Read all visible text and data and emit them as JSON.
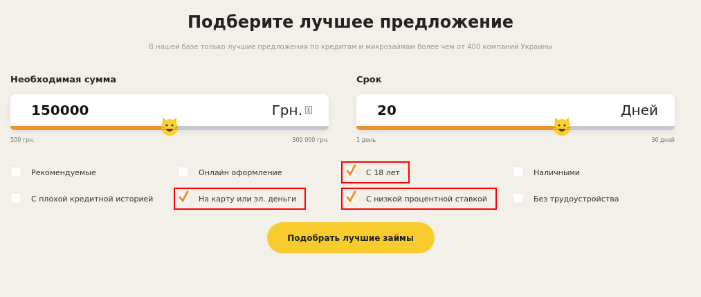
{
  "title": "Подберите лучшее предложение",
  "subtitle": "В нашей базе только лучшие предложения по кредитам и микрозаймам более чем от 400 компаний Украины",
  "sliders": [
    {
      "label": "Необходимая сумма",
      "value": "150000",
      "unit": "Грн.",
      "unit_icon": true,
      "level": 0.5,
      "min_label": "500 грн.",
      "max_label": "300 000 грн."
    },
    {
      "label": "Срок",
      "value": "20",
      "unit": "Дней",
      "unit_icon": false,
      "level": 0.645,
      "min_label": "1 день",
      "max_label": "30 дней"
    }
  ],
  "filters": [
    {
      "label": "Рекомендуемые",
      "checked": false,
      "highlighted": false
    },
    {
      "label": "Онлайн оформление",
      "checked": false,
      "highlighted": false
    },
    {
      "label": "С 18 лет",
      "checked": true,
      "highlighted": true
    },
    {
      "label": "Наличными",
      "checked": false,
      "highlighted": false
    },
    {
      "label": "С плохой кредитной историей",
      "checked": false,
      "highlighted": false
    },
    {
      "label": "На карту или эл. деньги",
      "checked": true,
      "highlighted": true
    },
    {
      "label": "С низкой процентной ставкой",
      "checked": true,
      "highlighted": true
    },
    {
      "label": "Без трудоустройства",
      "checked": false,
      "highlighted": false
    }
  ],
  "submit": "Подобрать лучшие займы"
}
